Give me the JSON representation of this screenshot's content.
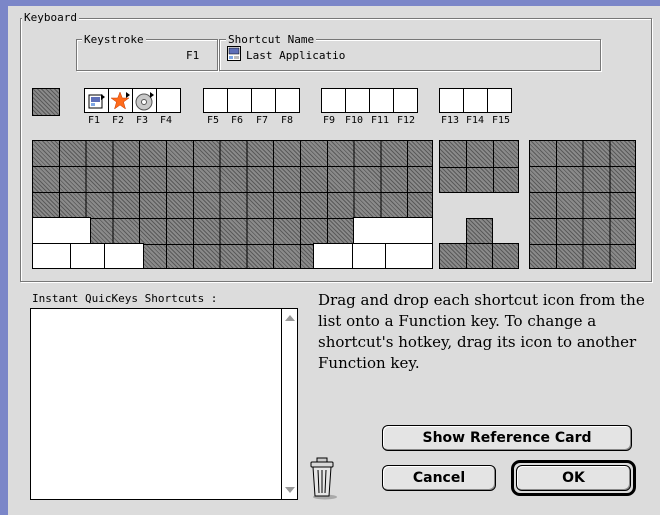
{
  "keyboard": {
    "group_label": "Keyboard",
    "keystroke": {
      "label": "Keystroke",
      "value": "F1"
    },
    "shortcut_name": {
      "label": "Shortcut Name",
      "value": "Last Applicatio"
    },
    "fkeys": [
      "F1",
      "F2",
      "F3",
      "F4",
      "F5",
      "F6",
      "F7",
      "F8",
      "F9",
      "F10",
      "F11",
      "F12",
      "F13",
      "F14",
      "F15"
    ]
  },
  "shortcuts_list": {
    "label": "Instant QuicKeys Shortcuts :"
  },
  "help_text": [
    "Drag and drop each shortcut icon from the",
    "list onto a Function key. To change a",
    "shortcut's hotkey, drag its icon to another",
    "Function key."
  ],
  "buttons": {
    "reference": "Show Reference Card",
    "cancel": "Cancel",
    "ok": "OK"
  },
  "icons": {
    "f1": "application-window-icon",
    "f2": "star-icon",
    "f3": "cd-disc-icon",
    "shortcut": "application-window-icon",
    "trash": "trash-can-icon"
  }
}
